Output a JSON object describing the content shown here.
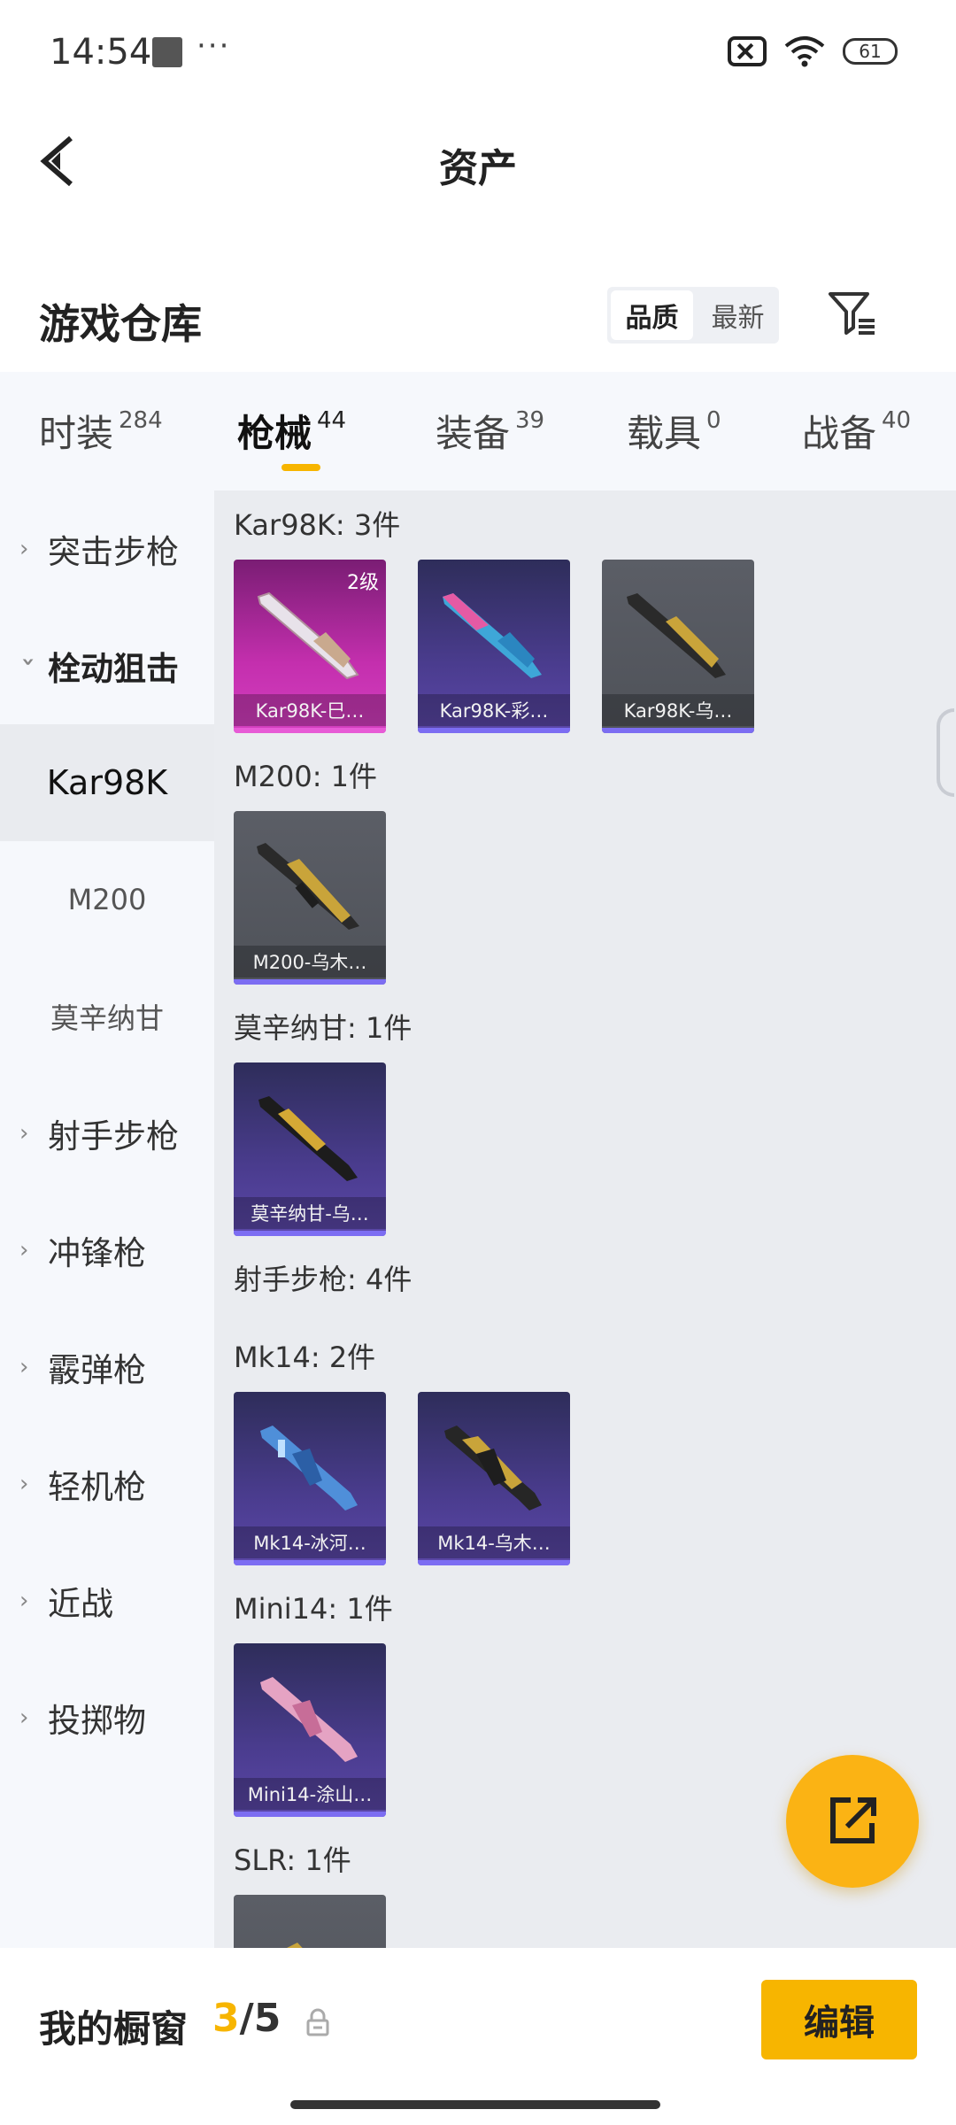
{
  "status_bar": {
    "time": "14:54",
    "dots": "···",
    "battery": "61"
  },
  "header": {
    "title": "资产"
  },
  "warehouse": {
    "title": "游戏仓库",
    "sort_options": [
      "品质",
      "最新"
    ]
  },
  "tabs": [
    {
      "label": "时装",
      "count": "284"
    },
    {
      "label": "枪械",
      "count": "44"
    },
    {
      "label": "装备",
      "count": "39"
    },
    {
      "label": "载具",
      "count": "0"
    },
    {
      "label": "战备",
      "count": "40"
    }
  ],
  "sidebar": {
    "items": [
      {
        "label": "突击步枪",
        "chevron": "›"
      },
      {
        "label": "栓动狙击",
        "chevron": "›"
      },
      {
        "label": "射手步枪",
        "chevron": "›"
      },
      {
        "label": "冲锋枪",
        "chevron": "›"
      },
      {
        "label": "霰弹枪",
        "chevron": "›"
      },
      {
        "label": "轻机枪",
        "chevron": "›"
      },
      {
        "label": "近战",
        "chevron": "›"
      },
      {
        "label": "投掷物",
        "chevron": "›"
      }
    ],
    "subitems": [
      "Kar98K",
      "M200",
      "莫辛纳甘"
    ]
  },
  "content": {
    "sections": [
      "Kar98K: 3件",
      "M200: 1件",
      "莫辛纳甘: 1件",
      "射手步枪: 4件",
      "Mk14: 2件",
      "Mini14: 1件",
      "SLR: 1件"
    ],
    "cards": [
      {
        "label": "Kar98K-巳…",
        "level": "2级",
        "color": "pink"
      },
      {
        "label": "Kar98K-彩…",
        "color": "purple"
      },
      {
        "label": "Kar98K-乌…",
        "color": "gray"
      },
      {
        "label": "M200-乌木…",
        "color": "gray"
      },
      {
        "label": "莫辛纳甘-乌…",
        "color": "purple"
      },
      {
        "label": "Mk14-冰河…",
        "color": "purple"
      },
      {
        "label": "Mk14-乌木…",
        "color": "purple"
      },
      {
        "label": "Mini14-涂山…",
        "color": "purple"
      }
    ]
  },
  "bottom_bar": {
    "title": "我的橱窗",
    "current": "3",
    "separator": "/",
    "total": "5",
    "edit_label": "编辑"
  },
  "icons": {
    "back": "back-arrow-icon",
    "filter": "filter-icon",
    "share": "share-icon",
    "lock": "lock-icon",
    "wifi": "wifi-icon",
    "notification_off": "notification-off-icon"
  }
}
